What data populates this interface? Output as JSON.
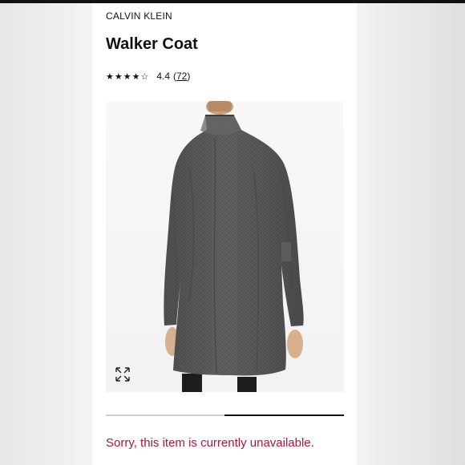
{
  "product": {
    "brand": "CALVIN KLEIN",
    "title": "Walker Coat",
    "rating": {
      "stars": "★★★★☆",
      "score": "4.4",
      "count_open": "(",
      "count": "72",
      "count_close": ")"
    }
  },
  "gallery": {
    "image_position_fraction": 0.5,
    "expand_icon": "expand-icon"
  },
  "status": {
    "message": "Sorry, this item is currently unavailable.",
    "color": "#b0143a"
  },
  "colors": {
    "card": "#ffffff",
    "text": "#111111",
    "coat": "#5a5a5a"
  }
}
